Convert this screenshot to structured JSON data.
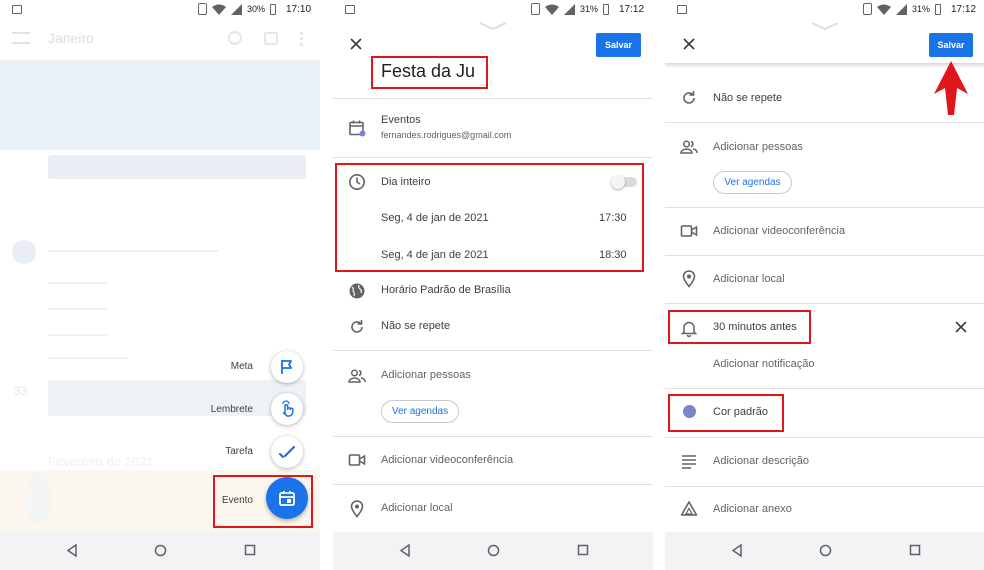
{
  "status": {
    "p1": {
      "battery": "30%",
      "time": "17:10"
    },
    "p2": {
      "battery": "31%",
      "time": "17:12"
    },
    "p3": {
      "battery": "31%",
      "time": "17:12"
    }
  },
  "screen1": {
    "month_label": "Janeiro",
    "month_label_2": "Fevereiro de 2021",
    "day_num": "33",
    "fab_menu": [
      {
        "label": "Meta",
        "icon": "flag-icon"
      },
      {
        "label": "Lembrete",
        "icon": "reminder-hand-icon"
      },
      {
        "label": "Tarefa",
        "icon": "task-check-icon"
      },
      {
        "label": "Evento",
        "icon": "event-calendar-icon"
      }
    ]
  },
  "screen2": {
    "save_label": "Salvar",
    "title": "Festa da Ju",
    "calendar_name": "Eventos",
    "calendar_account": "fernandes.rodrigues@gmail.com",
    "all_day_label": "Dia inteiro",
    "start_date": "Seg, 4 de jan de 2021",
    "start_time": "17:30",
    "end_date": "Seg, 4 de jan de 2021",
    "end_time": "18:30",
    "timezone": "Horário Padrão de Brasília",
    "repeat": "Não se repete",
    "add_people": "Adicionar pessoas",
    "view_schedules": "Ver agendas",
    "add_video": "Adicionar videoconferência",
    "add_location": "Adicionar local"
  },
  "screen3": {
    "save_label": "Salvar",
    "repeat": "Não se repete",
    "add_people": "Adicionar pessoas",
    "view_schedules": "Ver agendas",
    "add_video": "Adicionar videoconferência",
    "add_location": "Adicionar local",
    "notification": "30 minutos antes",
    "add_notification": "Adicionar notificação",
    "color": "Cor padrão",
    "add_description": "Adicionar descrição",
    "add_attachment": "Adicionar anexo"
  },
  "colors": {
    "accent": "#1a73e8",
    "highlight": "#e0161b",
    "default_color_dot": "#7986cb",
    "icon": "#5f6368"
  }
}
